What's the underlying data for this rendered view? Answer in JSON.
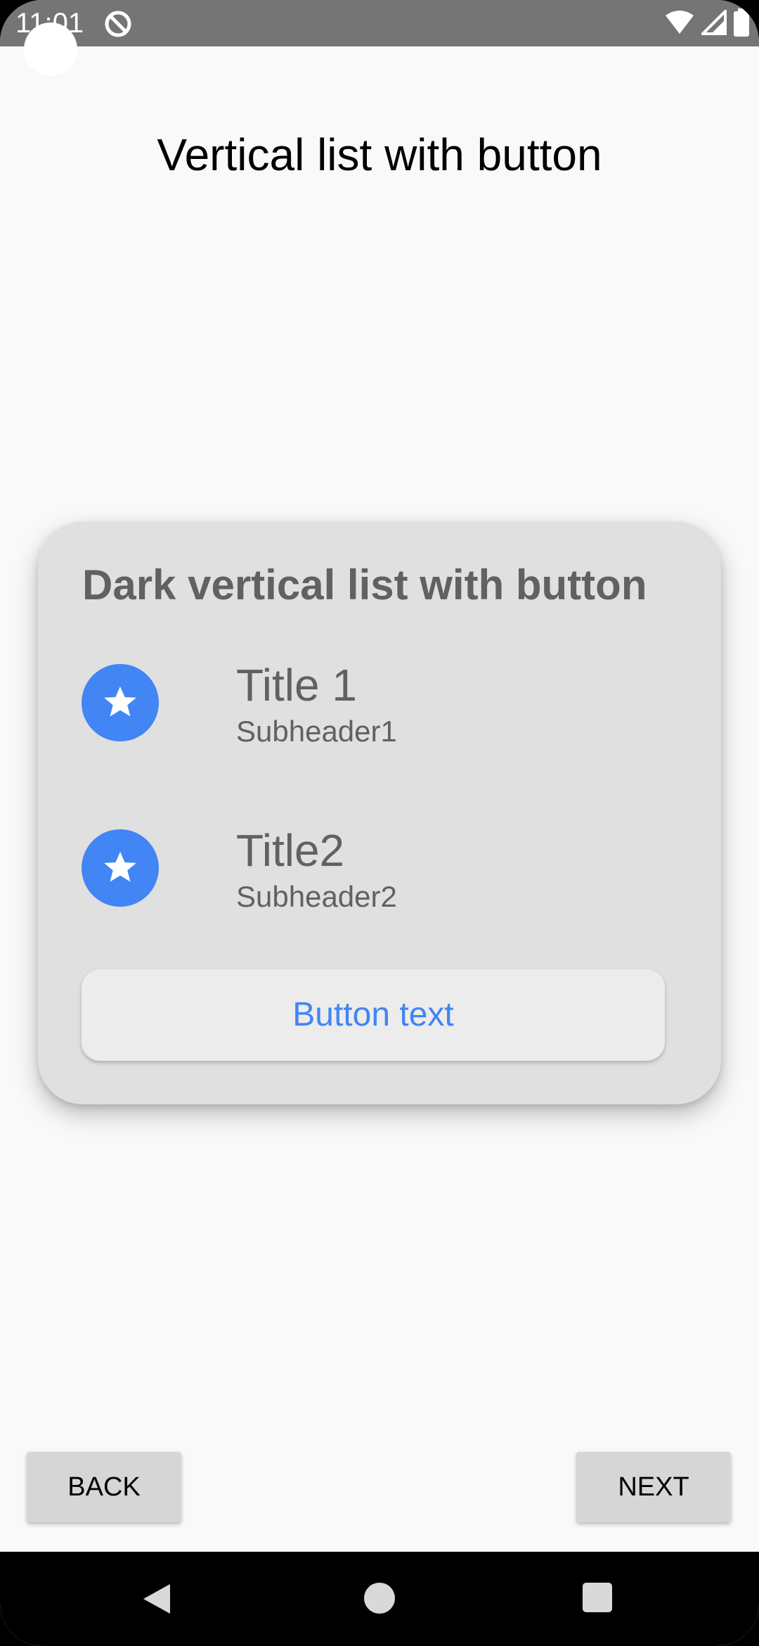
{
  "status_bar": {
    "time": "11:01",
    "icons": [
      "dnd-icon",
      "wifi-icon",
      "cell-signal-icon",
      "battery-icon"
    ]
  },
  "page": {
    "title": "Vertical list with button"
  },
  "card": {
    "title": "Dark vertical list with button",
    "items": [
      {
        "title": "Title 1",
        "subheader": "Subheader1",
        "icon": "star-icon"
      },
      {
        "title": "Title2",
        "subheader": "Subheader2",
        "icon": "star-icon"
      }
    ],
    "button_label": "Button text"
  },
  "navigation": {
    "back_label": "BACK",
    "next_label": "NEXT"
  },
  "colors": {
    "accent": "#4285f4",
    "card_background": "#e0e0e0",
    "page_background": "#f9f9f9",
    "status_bar": "#757575"
  }
}
